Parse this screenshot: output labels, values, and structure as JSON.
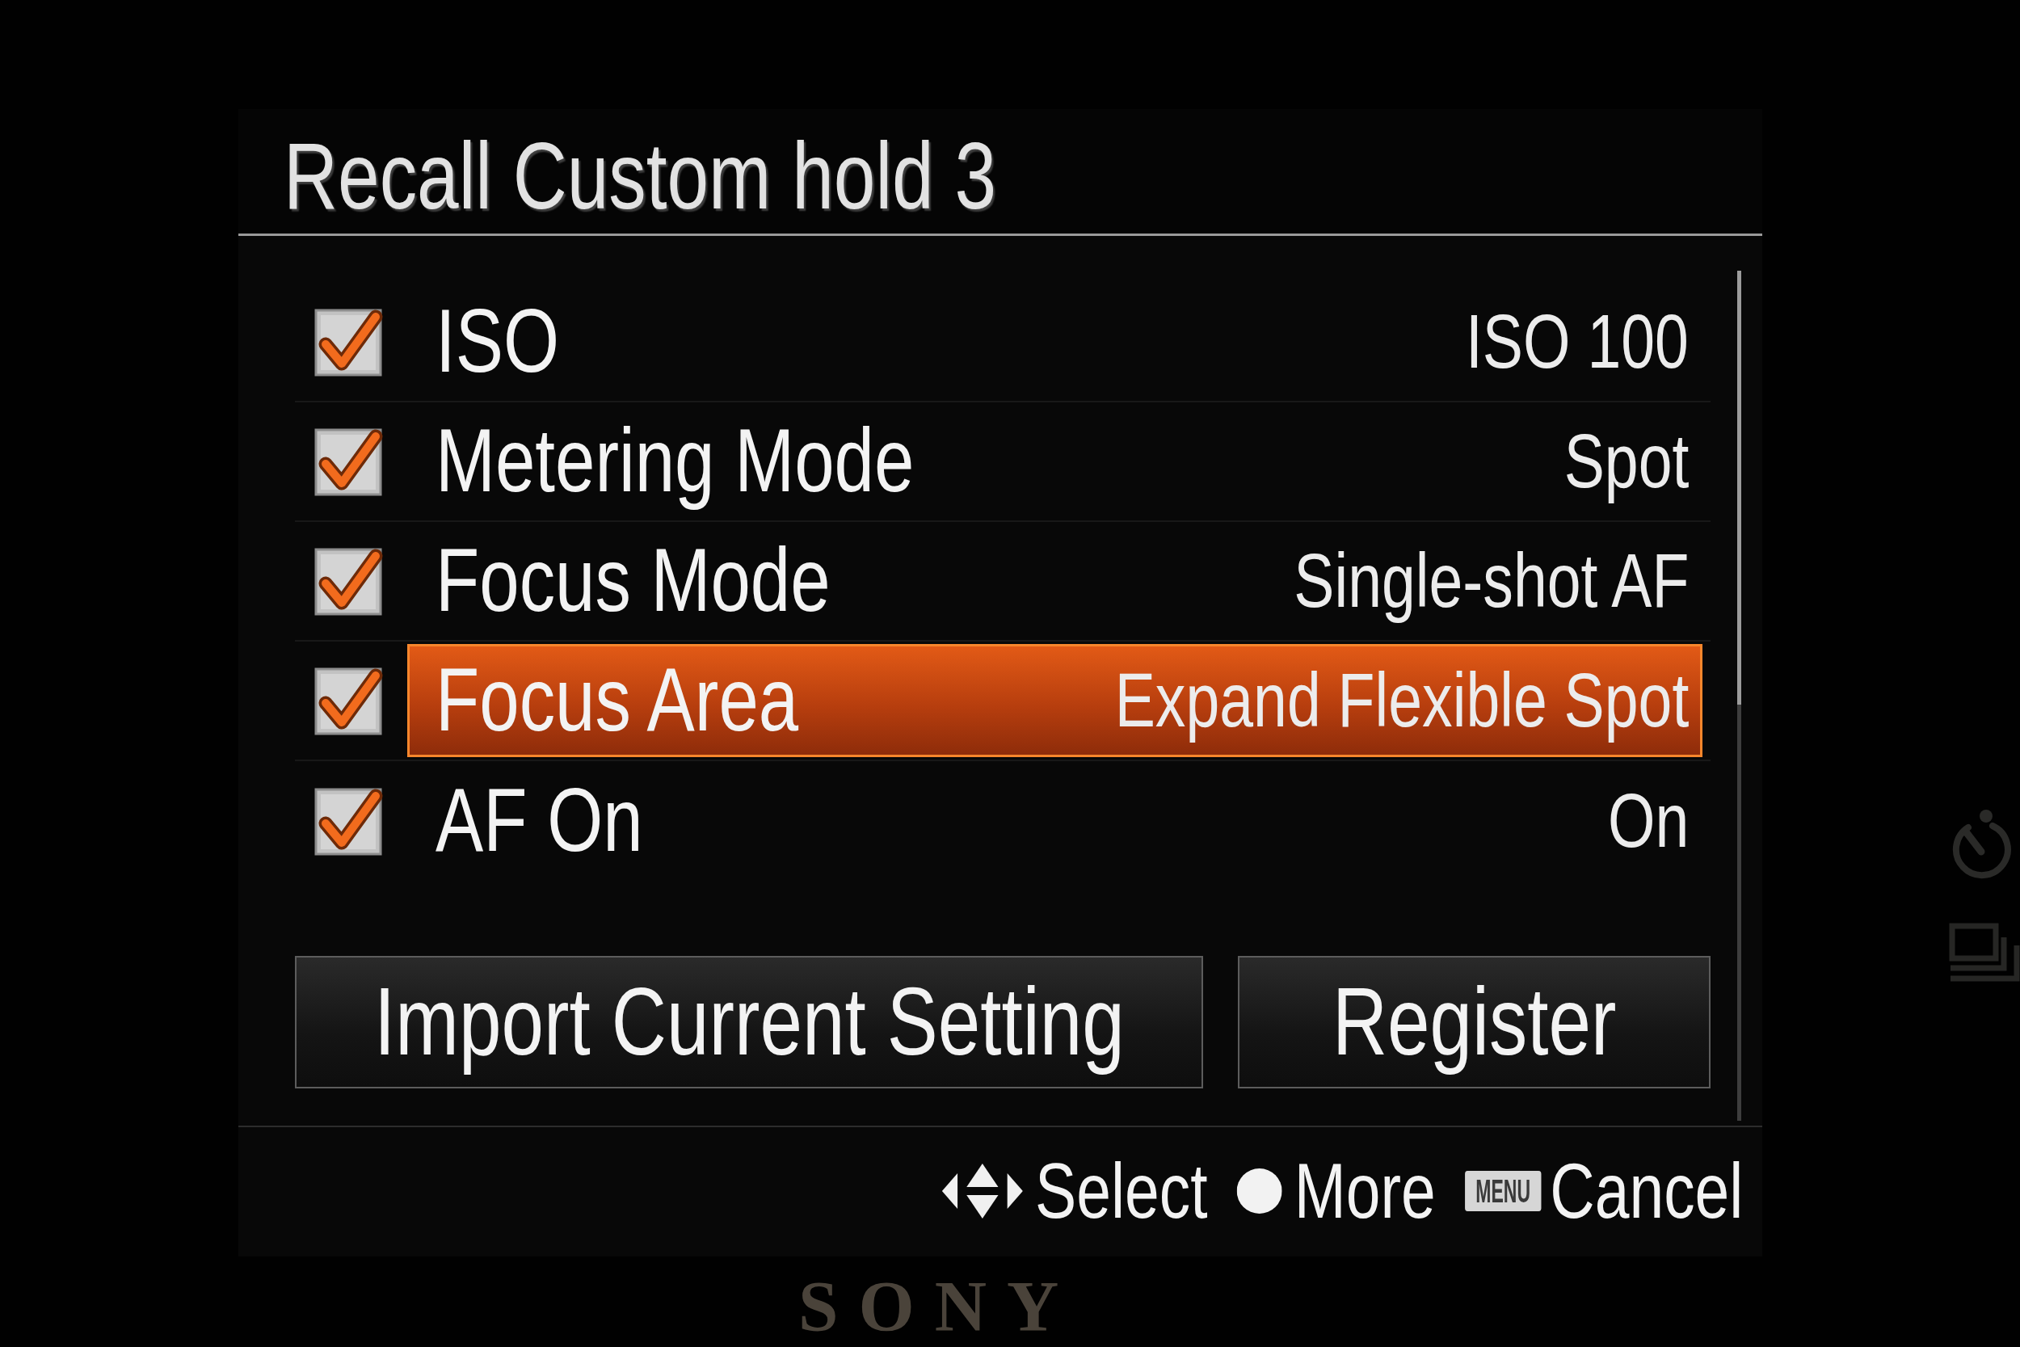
{
  "screen": {
    "title": "Recall Custom hold 3",
    "items": [
      {
        "label": "ISO",
        "value": "ISO 100",
        "checked": true,
        "selected": false
      },
      {
        "label": "Metering Mode",
        "value": "Spot",
        "checked": true,
        "selected": false
      },
      {
        "label": "Focus Mode",
        "value": "Single-shot AF",
        "checked": true,
        "selected": false
      },
      {
        "label": "Focus Area",
        "value": "Expand Flexible Spot",
        "checked": true,
        "selected": true
      },
      {
        "label": "AF On",
        "value": "On",
        "checked": true,
        "selected": false
      }
    ],
    "buttons": [
      {
        "label": "Import Current Setting",
        "selected": false
      },
      {
        "label": "Register",
        "selected": false
      }
    ],
    "footer_hints": [
      {
        "kind": "arrows",
        "label": "Select"
      },
      {
        "kind": "dot",
        "label": "More"
      },
      {
        "kind": "key",
        "key": "MENU",
        "label": "Cancel"
      }
    ]
  },
  "camera_body": {
    "logo": "SONY"
  }
}
